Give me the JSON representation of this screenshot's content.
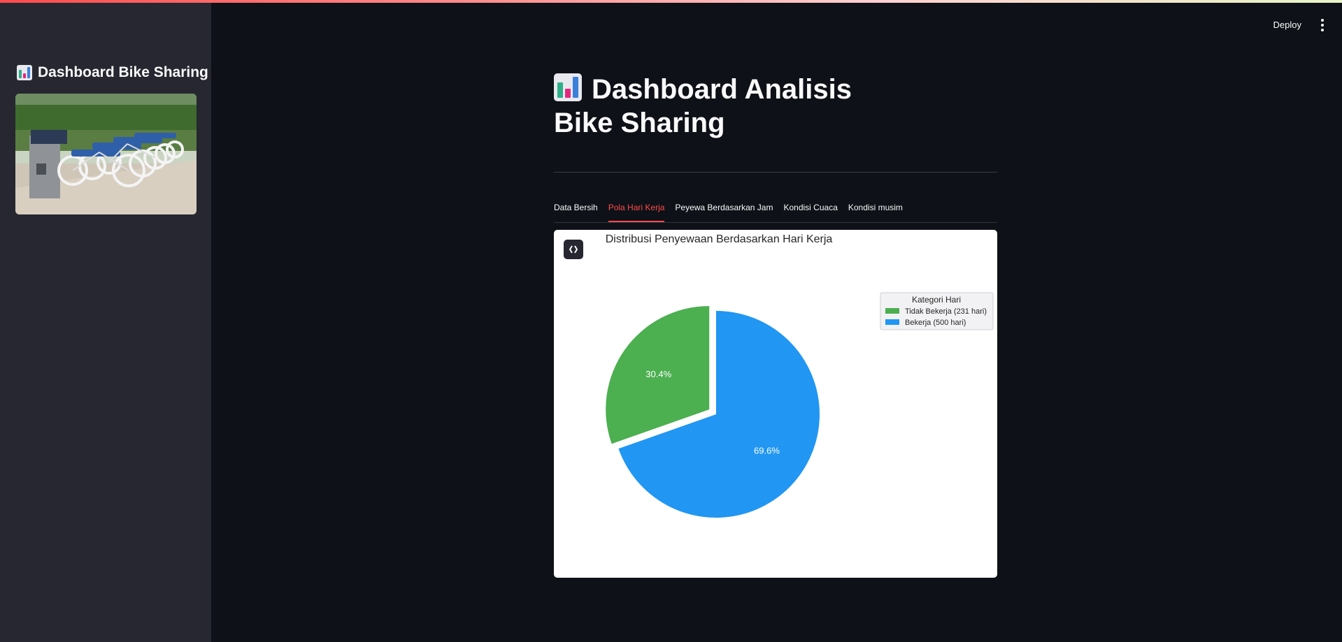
{
  "app": {
    "deploy_label": "Deploy",
    "menu_icon": "kebab-menu-icon"
  },
  "sidebar": {
    "title": "Dashboard Bike Sharing",
    "title_icon": "bar-chart-emoji-icon",
    "image_icon": "bike-sharing-station-photo"
  },
  "main": {
    "title": "Dashboard Analisis Bike Sharing",
    "title_icon": "bar-chart-emoji-icon",
    "tabs": [
      {
        "label": "Data Bersih",
        "active": false
      },
      {
        "label": "Pola Hari Kerja",
        "active": true
      },
      {
        "label": "Peyewa Berdasarkan Jam",
        "active": false
      },
      {
        "label": "Kondisi Cuaca",
        "active": false
      },
      {
        "label": "Kondisi musim",
        "active": false
      }
    ],
    "chart_toggle_icon": "keyboard-double-arrow-icon"
  },
  "colors": {
    "accent": "#ff4b4b",
    "background": "#0e1117",
    "sidebar": "#262730",
    "series_green": "#4caf50",
    "series_blue": "#2196f3"
  },
  "chart_data": {
    "type": "pie",
    "title": "Distribusi Penyewaan Berdasarkan Hari Kerja",
    "categories": [
      "Tidak Bekerja (231 hari)",
      "Bekerja (500 hari)"
    ],
    "values": [
      30.4,
      69.6
    ],
    "labels": [
      "30.4%",
      "69.6%"
    ],
    "colors": [
      "#4caf50",
      "#2196f3"
    ],
    "exploded": [
      true,
      false
    ],
    "legend": {
      "title": "Kategori Hari",
      "placement": "top-right"
    }
  }
}
